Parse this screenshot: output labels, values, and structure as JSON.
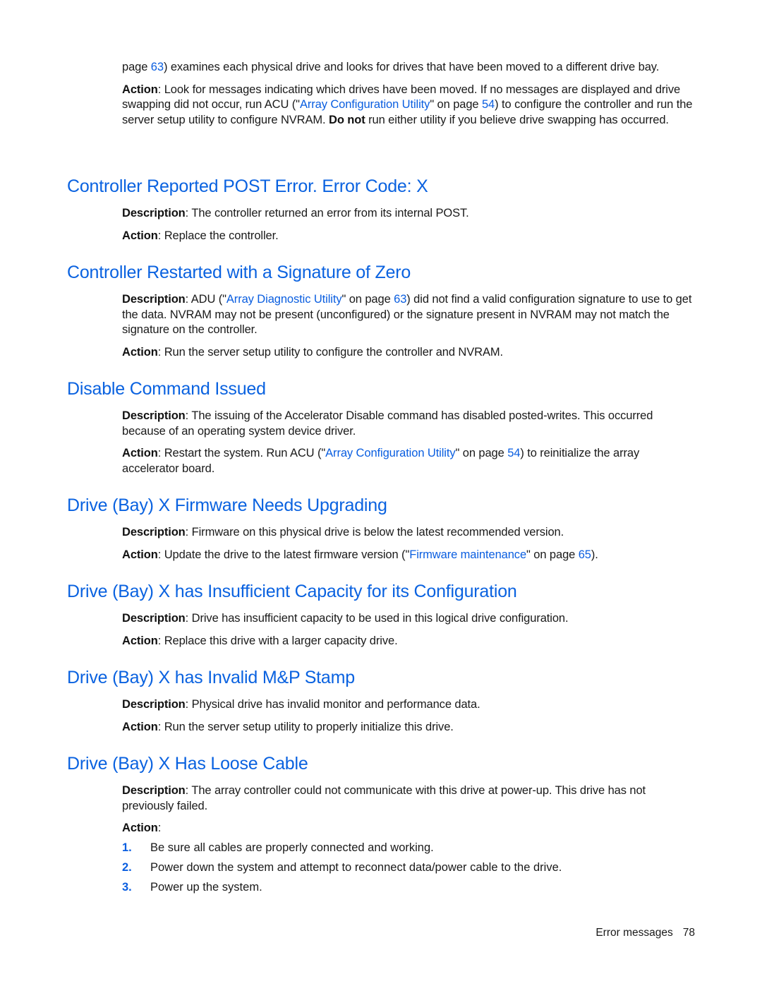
{
  "intro": {
    "line1_prefix": "page ",
    "line1_page": "63",
    "line1_suffix": ") examines each physical drive and looks for drives that have been moved to a different drive bay.",
    "action_label": "Action",
    "action_pre": ": Look for messages indicating which drives have been moved. If no messages are displayed and drive swapping did not occur, run ACU (\"",
    "action_link": "Array Configuration Utility",
    "action_mid": "\" on page ",
    "action_page": "54",
    "action_post": ") to configure the controller and run the server setup utility to configure NVRAM. ",
    "action_bold": "Do not",
    "action_end": " run either utility if you believe drive swapping has occurred."
  },
  "sections": [
    {
      "title": "Controller Reported POST Error. Error Code: X",
      "description_label": "Description",
      "description": ": The controller returned an error from its internal POST.",
      "action_label": "Action",
      "action": ": Replace the controller."
    },
    {
      "title": "Controller Restarted with a Signature of Zero",
      "description_label": "Description",
      "description_pre": ": ADU (\"",
      "description_link": "Array Diagnostic Utility",
      "description_mid": "\" on page ",
      "description_page": "63",
      "description_post": ") did not find a valid configuration signature to use to get the data. NVRAM may not be present (unconfigured) or the signature present in NVRAM may not match the signature on the controller.",
      "action_label": "Action",
      "action": ": Run the server setup utility to configure the controller and NVRAM."
    },
    {
      "title": "Disable Command Issued",
      "description_label": "Description",
      "description": ": The issuing of the Accelerator Disable command has disabled posted-writes. This occurred because of an operating system device driver.",
      "action_label": "Action",
      "action_pre": ": Restart the system. Run ACU (\"",
      "action_link": "Array Configuration Utility",
      "action_mid": "\" on page ",
      "action_page": "54",
      "action_post": ") to reinitialize the array accelerator board."
    },
    {
      "title": "Drive (Bay) X Firmware Needs Upgrading",
      "description_label": "Description",
      "description": ": Firmware on this physical drive is below the latest recommended version.",
      "action_label": "Action",
      "action_pre": ": Update the drive to the latest firmware version (\"",
      "action_link": "Firmware maintenance",
      "action_mid": "\" on page ",
      "action_page": "65",
      "action_post": ")."
    },
    {
      "title": "Drive (Bay) X has Insufficient Capacity for its Configuration",
      "description_label": "Description",
      "description": ": Drive has insufficient capacity to be used in this logical drive configuration.",
      "action_label": "Action",
      "action": ": Replace this drive with a larger capacity drive."
    },
    {
      "title": "Drive (Bay) X has Invalid M&P Stamp",
      "description_label": "Description",
      "description": ": Physical drive has invalid monitor and performance data.",
      "action_label": "Action",
      "action": ": Run the server setup utility to properly initialize this drive."
    },
    {
      "title": "Drive (Bay) X Has Loose Cable",
      "description_label": "Description",
      "description": ": The array controller could not communicate with this drive at power-up. This drive has not previously failed.",
      "action_label": "Action",
      "action": ":",
      "steps": [
        {
          "num": "1.",
          "text": "Be sure all cables are properly connected and working."
        },
        {
          "num": "2.",
          "text": "Power down the system and attempt to reconnect data/power cable to the drive."
        },
        {
          "num": "3.",
          "text": "Power up the system."
        }
      ]
    }
  ],
  "footer": {
    "section": "Error messages",
    "page": "78"
  }
}
